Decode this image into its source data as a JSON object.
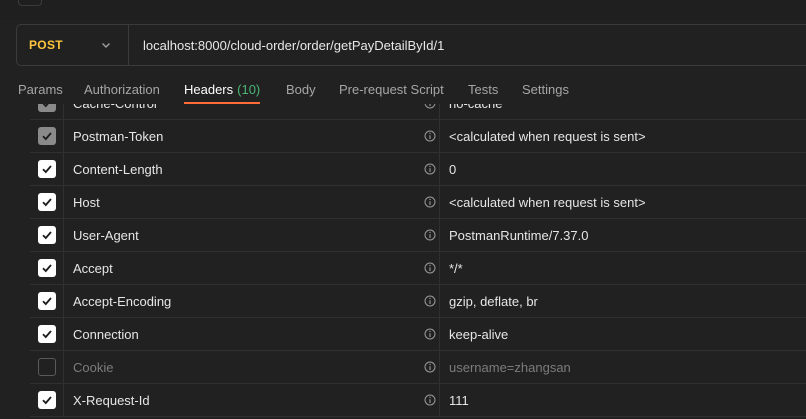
{
  "request": {
    "method": "POST",
    "url": "localhost:8000/cloud-order/order/getPayDetailById/1"
  },
  "tabs": [
    {
      "label": "Params",
      "count": ""
    },
    {
      "label": "Authorization",
      "count": ""
    },
    {
      "label": "Headers",
      "count": "(10)"
    },
    {
      "label": "Body",
      "count": ""
    },
    {
      "label": "Pre-request Script",
      "count": ""
    },
    {
      "label": "Tests",
      "count": ""
    },
    {
      "label": "Settings",
      "count": ""
    }
  ],
  "active_tab": "Headers",
  "headers": [
    {
      "key": "Cache-Control",
      "value": "no-cache",
      "state": "dim"
    },
    {
      "key": "Postman-Token",
      "value": "<calculated when request is sent>",
      "state": "dim"
    },
    {
      "key": "Content-Length",
      "value": "0",
      "state": "on"
    },
    {
      "key": "Host",
      "value": "<calculated when request is sent>",
      "state": "on"
    },
    {
      "key": "User-Agent",
      "value": "PostmanRuntime/7.37.0",
      "state": "on"
    },
    {
      "key": "Accept",
      "value": "*/*",
      "state": "on"
    },
    {
      "key": "Accept-Encoding",
      "value": "gzip, deflate, br",
      "state": "on"
    },
    {
      "key": "Connection",
      "value": "keep-alive",
      "state": "on"
    },
    {
      "key": "Cookie",
      "value": "username=zhangsan",
      "state": "off"
    },
    {
      "key": "X-Request-Id",
      "value": "111",
      "state": "on"
    }
  ],
  "colors": {
    "method": "#ffc53d",
    "active_tab_underline": "#ff6c37",
    "tab_count": "#49b675"
  },
  "icons": {
    "method_dropdown": "chevron-down-icon",
    "header_info": "info-icon",
    "checkbox": "check-icon"
  }
}
